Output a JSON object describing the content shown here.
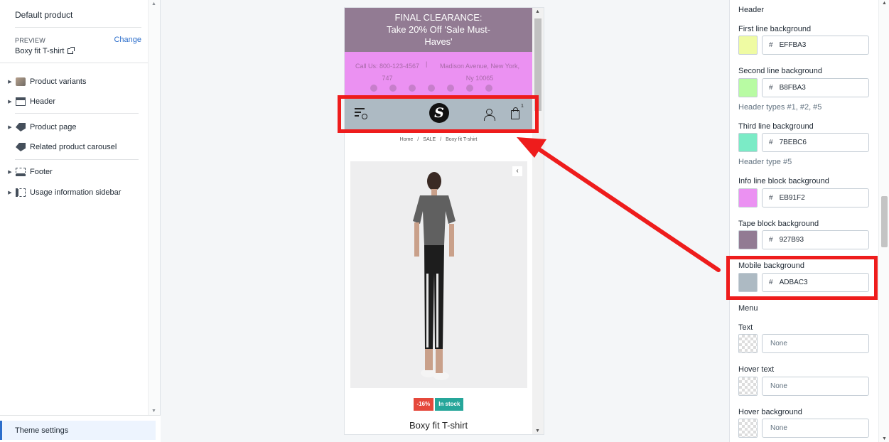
{
  "sidebar": {
    "title": "Default product",
    "preview_label": "PREVIEW",
    "change_link": "Change",
    "preview_value": "Boxy fit T-shirt",
    "items": [
      {
        "label": "Product variants",
        "icon": "product-variants-icon"
      },
      {
        "label": "Header",
        "icon": "header-icon"
      },
      {
        "label": "Product page",
        "icon": "tag-icon"
      },
      {
        "label": "Related product carousel",
        "icon": "tag-icon"
      },
      {
        "label": "Footer",
        "icon": "footer-icon"
      },
      {
        "label": "Usage information sidebar",
        "icon": "sidebar-icon"
      }
    ],
    "theme_settings": "Theme settings"
  },
  "preview": {
    "tape_text": [
      "FINAL CLEARANCE:",
      "Take 20% Off 'Sale Must-",
      "Haves'"
    ],
    "phone": "Call Us: 800-123-4567 747",
    "separator": "|",
    "address": "Madison Avenue, New York, Ny 10065",
    "logo_letter": "S",
    "cart_count": "1",
    "breadcrumb": {
      "home": "Home",
      "sep": "/",
      "sale": "SALE",
      "current": "Boxy fit T-shirt"
    },
    "badge_sale": "-16%",
    "badge_stock": "In stock",
    "product_name": "Boxy fit T-shirt",
    "colors": {
      "tape": "#927b93",
      "info": "#eb91f2",
      "mobile": "#adbac3"
    }
  },
  "settings": {
    "section_header": "Header",
    "fields": [
      {
        "label": "First line background",
        "value": "EFFBA3",
        "color": "#effba3"
      },
      {
        "label": "Second line background",
        "value": "B8FBA3",
        "color": "#b8fba3",
        "help": "Header types #1, #2, #5"
      },
      {
        "label": "Third line background",
        "value": "7BEBC6",
        "color": "#7bebc6",
        "help": "Header type #5"
      },
      {
        "label": "Info line block background",
        "value": "EB91F2",
        "color": "#eb91f2"
      },
      {
        "label": "Tape block background",
        "value": "927B93",
        "color": "#927b93"
      },
      {
        "label": "Mobile background",
        "value": "ADBAC3",
        "color": "#adbac3"
      }
    ],
    "hash": "#",
    "section_menu": "Menu",
    "menu_fields": [
      {
        "label": "Text",
        "placeholder": "None"
      },
      {
        "label": "Hover text",
        "placeholder": "None"
      },
      {
        "label": "Hover background",
        "placeholder": "None"
      }
    ]
  },
  "annotation": {
    "highlight_color": "#ee1c1c"
  }
}
